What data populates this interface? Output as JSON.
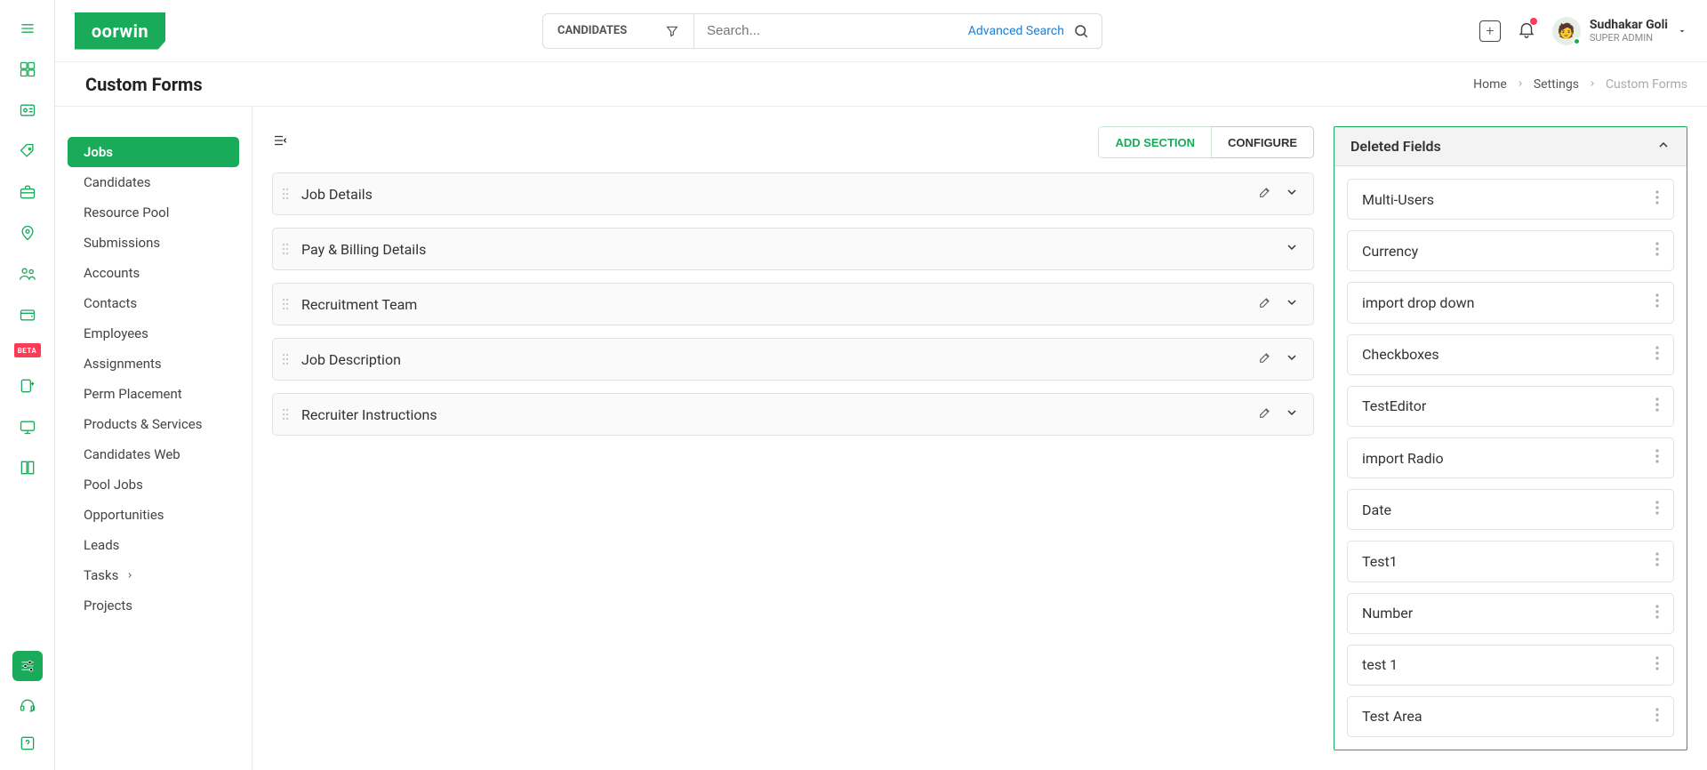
{
  "brand": "oorwin",
  "search_category": "CANDIDATES",
  "search_placeholder": "Search...",
  "advanced_search": "Advanced Search",
  "user": {
    "name": "Sudhakar Goli",
    "role": "SUPER ADMIN"
  },
  "page_title": "Custom Forms",
  "breadcrumb": {
    "home": "Home",
    "settings": "Settings",
    "current": "Custom Forms"
  },
  "sidebar": {
    "items": [
      {
        "label": "Jobs"
      },
      {
        "label": "Candidates"
      },
      {
        "label": "Resource Pool"
      },
      {
        "label": "Submissions"
      },
      {
        "label": "Accounts"
      },
      {
        "label": "Contacts"
      },
      {
        "label": "Employees"
      },
      {
        "label": "Assignments"
      },
      {
        "label": "Perm Placement"
      },
      {
        "label": "Products & Services"
      },
      {
        "label": "Candidates Web"
      },
      {
        "label": "Pool Jobs"
      },
      {
        "label": "Opportunities"
      },
      {
        "label": "Leads"
      },
      {
        "label": "Tasks"
      },
      {
        "label": "Projects"
      }
    ]
  },
  "buttons": {
    "add_section": "ADD SECTION",
    "configure": "CONFIGURE"
  },
  "sections": [
    {
      "label": "Job Details",
      "editable": true
    },
    {
      "label": "Pay & Billing Details",
      "editable": false
    },
    {
      "label": "Recruitment Team",
      "editable": true
    },
    {
      "label": "Job Description",
      "editable": true
    },
    {
      "label": "Recruiter Instructions",
      "editable": true
    }
  ],
  "deleted_panel": {
    "title": "Deleted Fields",
    "items": [
      {
        "label": "Multi-Users"
      },
      {
        "label": "Currency"
      },
      {
        "label": "import drop down"
      },
      {
        "label": "Checkboxes"
      },
      {
        "label": "TestEditor"
      },
      {
        "label": "import Radio"
      },
      {
        "label": "Date"
      },
      {
        "label": "Test1"
      },
      {
        "label": "Number"
      },
      {
        "label": "test 1"
      },
      {
        "label": "Test Area"
      }
    ]
  },
  "rail_beta": "BETA"
}
